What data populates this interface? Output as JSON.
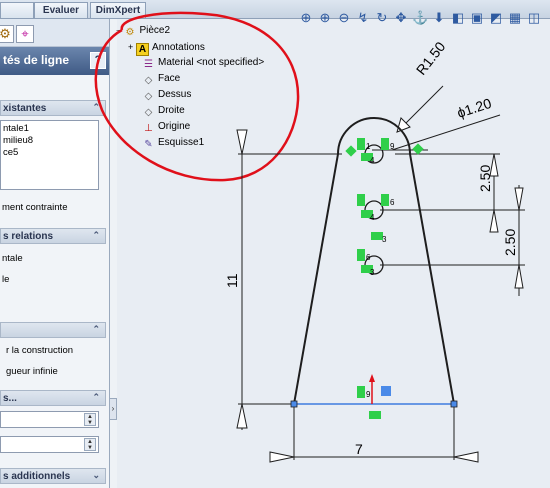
{
  "tabs": [
    "Evaluer",
    "DimXpert"
  ],
  "panel": {
    "title": "tés de ligne",
    "help": "?",
    "sections": {
      "existing": "xistantes",
      "relations": "s relations",
      "options_blank": "",
      "params": "s...",
      "additional": "s additionnels"
    },
    "existing_list": [
      "ntale1",
      "milieu8",
      "ce5"
    ],
    "status_text": "ment contrainte",
    "relations_item": "ntale",
    "relations_item2": "le",
    "option1": "r la construction",
    "option2": "gueur infinie",
    "chevron_up": "⌃",
    "chevron_down": "⌄"
  },
  "tree": {
    "root": "Pièce2",
    "items": [
      "Annotations",
      "Material <not specified>",
      "Face",
      "Dessus",
      "Droite",
      "Origine",
      "Esquisse1"
    ]
  },
  "dimensions": {
    "radius": "R1.50",
    "diameter": "ϕ1.20",
    "spacing1": "2.50",
    "spacing2": "2.50",
    "height": "11",
    "width": "7"
  },
  "relation_tags": [
    "1",
    "9",
    "4",
    "6",
    "4",
    "3",
    "6",
    "3",
    "9"
  ],
  "colors": {
    "sketch_line": "#1e1e1e",
    "selected_line": "#3d7de0",
    "relation_green": "#2fcf4a",
    "annotation_red": "#e0101a",
    "panel_title": "#4a6591"
  }
}
